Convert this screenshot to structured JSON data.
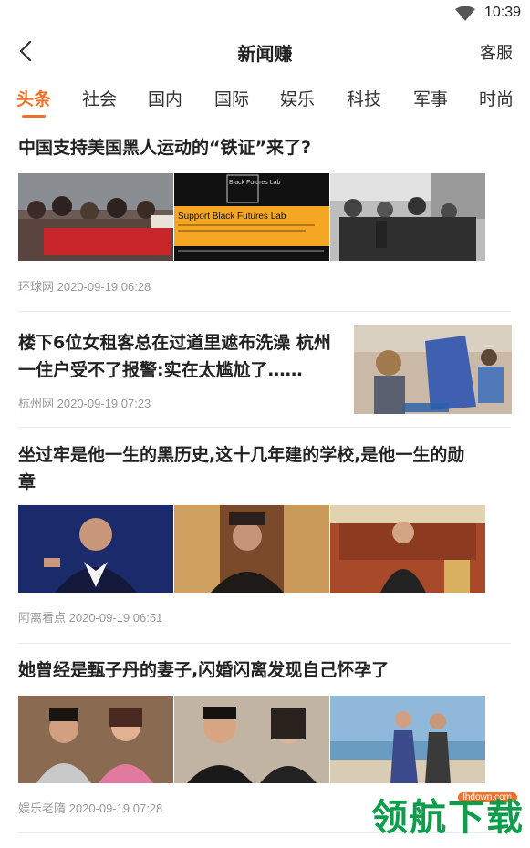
{
  "status": {
    "time": "10:39",
    "wifi_icon": "wifi-icon"
  },
  "nav": {
    "back_icon": "chevron-left-icon",
    "title": "新闻赚",
    "right_label": "客服"
  },
  "tabs": [
    {
      "label": "头条",
      "active": true
    },
    {
      "label": "社会"
    },
    {
      "label": "国内"
    },
    {
      "label": "国际"
    },
    {
      "label": "娱乐"
    },
    {
      "label": "科技"
    },
    {
      "label": "军事"
    },
    {
      "label": "时尚"
    }
  ],
  "news": [
    {
      "title": "中国支持美国黑人运动的“铁证”来了?",
      "source": "环球网",
      "time": "2020-09-19 06:28",
      "images": [
        "protest-photo",
        "black-futures-lab-banner",
        "historical-photo"
      ],
      "banner_text": {
        "logo": "Black Futures Lab",
        "headline": "Support Black Futures Lab"
      }
    },
    {
      "title_line1": "楼下6位女租客总在过道里遮布洗澡 杭州",
      "title_line2": "一住户受不了报警:实在太尴尬了……",
      "source": "杭州网",
      "time": "2020-09-19 07:23",
      "images": [
        "shower-tent-photo"
      ]
    },
    {
      "title_line1": "坐过牢是他一生的黑历史,这十几年建的学校,是他一生的勋",
      "title_line2": "章",
      "source": "阿离看点",
      "time": "2020-09-19 06:51",
      "images": [
        "actor-portrait-photo",
        "actor-costume-photo",
        "actor-suit-photo"
      ]
    },
    {
      "title": "她曾经是甄子丹的妻子,闪婚闪离发现自己怀孕了",
      "source": "娱乐老隋",
      "time": "2020-09-19 07:28",
      "images": [
        "couple-drama-photo",
        "couple-portrait-photo",
        "couple-beach-photo"
      ]
    }
  ],
  "watermark": {
    "text": "领航下载",
    "url": "lhdown.com"
  },
  "colors": {
    "accent": "#f0722a",
    "watermark": "#0e9d4a"
  }
}
